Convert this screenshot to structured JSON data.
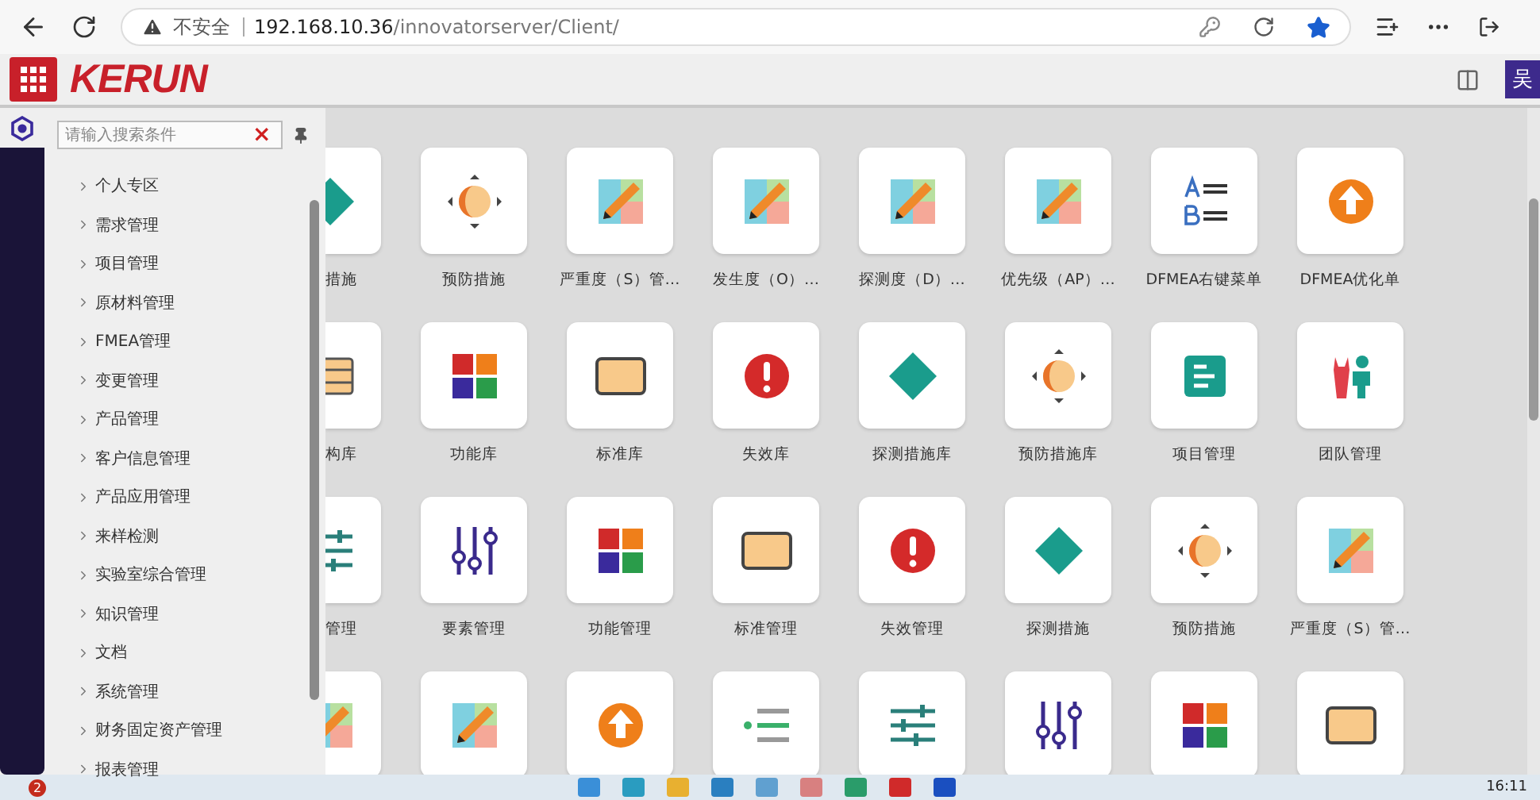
{
  "browser": {
    "security": "不安全",
    "url_host": "192.168.10.36",
    "url_path": "/innovatorserver/Client/"
  },
  "app": {
    "logo": "KERUN",
    "user": "吴"
  },
  "sidebar": {
    "search": {
      "placeholder": "请输入搜索条件",
      "clear": "×"
    },
    "items": [
      {
        "label": "个人专区"
      },
      {
        "label": "需求管理"
      },
      {
        "label": "项目管理"
      },
      {
        "label": "原材料管理"
      },
      {
        "label": "FMEA管理"
      },
      {
        "label": "变更管理"
      },
      {
        "label": "产品管理"
      },
      {
        "label": "客户信息管理"
      },
      {
        "label": "产品应用管理"
      },
      {
        "label": "来样检测"
      },
      {
        "label": "实验室综合管理"
      },
      {
        "label": "知识管理"
      },
      {
        "label": "文档"
      },
      {
        "label": "系统管理"
      },
      {
        "label": "财务固定资产管理"
      },
      {
        "label": "报表管理"
      }
    ]
  },
  "tiles": [
    [
      {
        "kind": "diamond",
        "label": "措施"
      },
      {
        "kind": "ball",
        "label": "预防措施"
      },
      {
        "kind": "pencil",
        "label": "严重度（S）管…"
      },
      {
        "kind": "pencil",
        "label": "发生度（O）…"
      },
      {
        "kind": "pencil",
        "label": "探测度（D）…"
      },
      {
        "kind": "pencil",
        "label": "优先级（AP）…"
      },
      {
        "kind": "ab",
        "label": "DFMEA右键菜单"
      },
      {
        "kind": "up",
        "label": "DFMEA优化单"
      }
    ],
    [
      {
        "kind": "stack",
        "label": "构库"
      },
      {
        "kind": "tiles",
        "label": "功能库"
      },
      {
        "kind": "rect",
        "label": "标准库"
      },
      {
        "kind": "alert",
        "label": "失效库"
      },
      {
        "kind": "diamond",
        "label": "探测措施库"
      },
      {
        "kind": "ball",
        "label": "预防措施库"
      },
      {
        "kind": "doc",
        "label": "项目管理"
      },
      {
        "kind": "team",
        "label": "团队管理"
      }
    ],
    [
      {
        "kind": "hsliders",
        "label": "管理"
      },
      {
        "kind": "vsliders",
        "label": "要素管理"
      },
      {
        "kind": "tiles",
        "label": "功能管理"
      },
      {
        "kind": "rect",
        "label": "标准管理"
      },
      {
        "kind": "alert",
        "label": "失效管理"
      },
      {
        "kind": "diamond",
        "label": "探测措施"
      },
      {
        "kind": "ball",
        "label": "预防措施"
      },
      {
        "kind": "pencil",
        "label": "严重度（S）管…"
      }
    ],
    [
      {
        "kind": "pencil"
      },
      {
        "kind": "pencil"
      },
      {
        "kind": "up"
      },
      {
        "kind": "list"
      },
      {
        "kind": "hsliders"
      },
      {
        "kind": "vsliders"
      },
      {
        "kind": "tiles"
      },
      {
        "kind": "rect"
      }
    ]
  ],
  "taskbar": {
    "badge": "2",
    "time": "16:11"
  }
}
